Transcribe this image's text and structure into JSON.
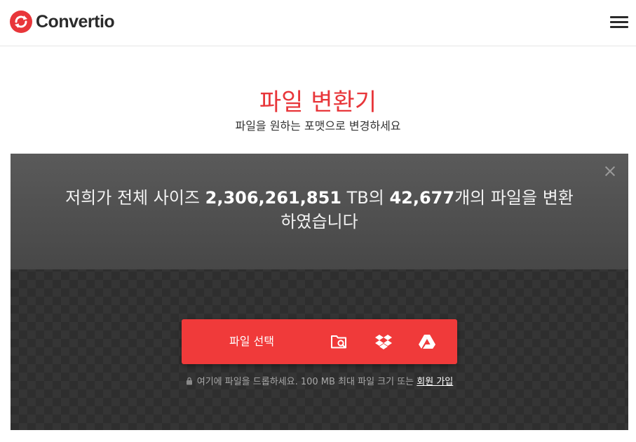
{
  "header": {
    "brand": "Convertio",
    "logo_icon": "convertio-logo-icon",
    "menu_icon": "hamburger-menu-icon"
  },
  "hero": {
    "title": "파일 변환기",
    "subtitle": "파일을 원하는 포맷으로 변경하세요"
  },
  "stats": {
    "prefix": "저희가 전체 사이즈 ",
    "size": "2,306,261,851",
    "unit": " TB의 ",
    "count": "42,677",
    "suffix_line1": "개의 파일을 변환",
    "suffix_line2": "하였습니다"
  },
  "upload": {
    "label": "파일 선택",
    "sources": [
      "folder-search-icon",
      "dropbox-icon",
      "google-drive-icon"
    ]
  },
  "note": {
    "text": "여기에 파일을 드롭하세요. 100 MB 최대 파일 크기 또는 ",
    "link": "회원 가입"
  },
  "colors": {
    "brand_red": "#e8363a",
    "button_red": "#f03a3a",
    "panel_dark": "#2e2e2e",
    "panel_top": "#525252"
  }
}
